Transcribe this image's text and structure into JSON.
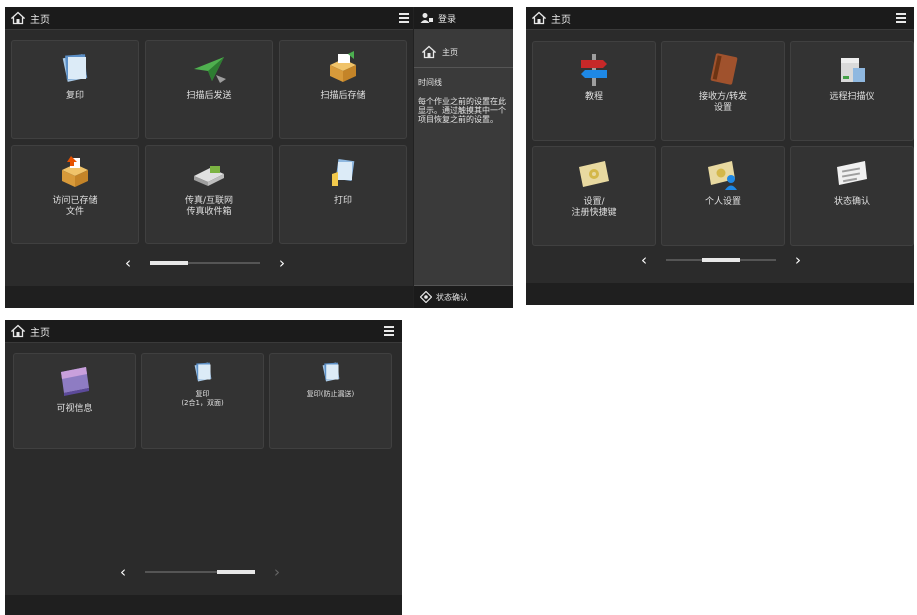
{
  "panel1": {
    "home_label": "主页",
    "tiles": [
      {
        "label": "复印",
        "icon": "copy-icon"
      },
      {
        "label": "扫描后发送",
        "icon": "send-plane-icon"
      },
      {
        "label": "扫描后存储",
        "icon": "scan-store-icon"
      },
      {
        "label": "访问已存储\n文件",
        "icon": "stored-files-icon"
      },
      {
        "label": "传真/互联网\n传真收件箱",
        "icon": "fax-inbox-icon"
      },
      {
        "label": "打印",
        "icon": "print-icon"
      }
    ],
    "side": {
      "login_label": "登录",
      "home_label": "主页",
      "title": "时间线",
      "text": "每个作业之前的设置在此显示。通过触摸其中一个项目恢复之前的设置。",
      "status_label": "状态确认"
    }
  },
  "panel2": {
    "home_label": "主页",
    "tiles": [
      {
        "label": "教程",
        "icon": "signpost-icon"
      },
      {
        "label": "接收方/转发\n设置",
        "icon": "address-book-icon"
      },
      {
        "label": "远程扫描仪",
        "icon": "remote-scanner-icon"
      },
      {
        "label": "设置/\n注册快捷键",
        "icon": "settings-shortcut-icon"
      },
      {
        "label": "个人设置",
        "icon": "personal-settings-icon"
      },
      {
        "label": "状态确认",
        "icon": "status-check-icon"
      }
    ]
  },
  "panel3": {
    "home_label": "主页",
    "tiles": [
      {
        "label": "可视信息",
        "icon": "visual-message-icon"
      },
      {
        "label": "复印\n(2合1，双面)",
        "icon": "copy-2in1-icon"
      },
      {
        "label": "复印(防止漏送)",
        "icon": "copy-prevent-icon"
      }
    ]
  },
  "colors": {
    "panel_bg": "#2b2b2b",
    "bar_bg": "#1b1b1b",
    "tile_bg": "#333333",
    "text": "#e6e6e6"
  }
}
